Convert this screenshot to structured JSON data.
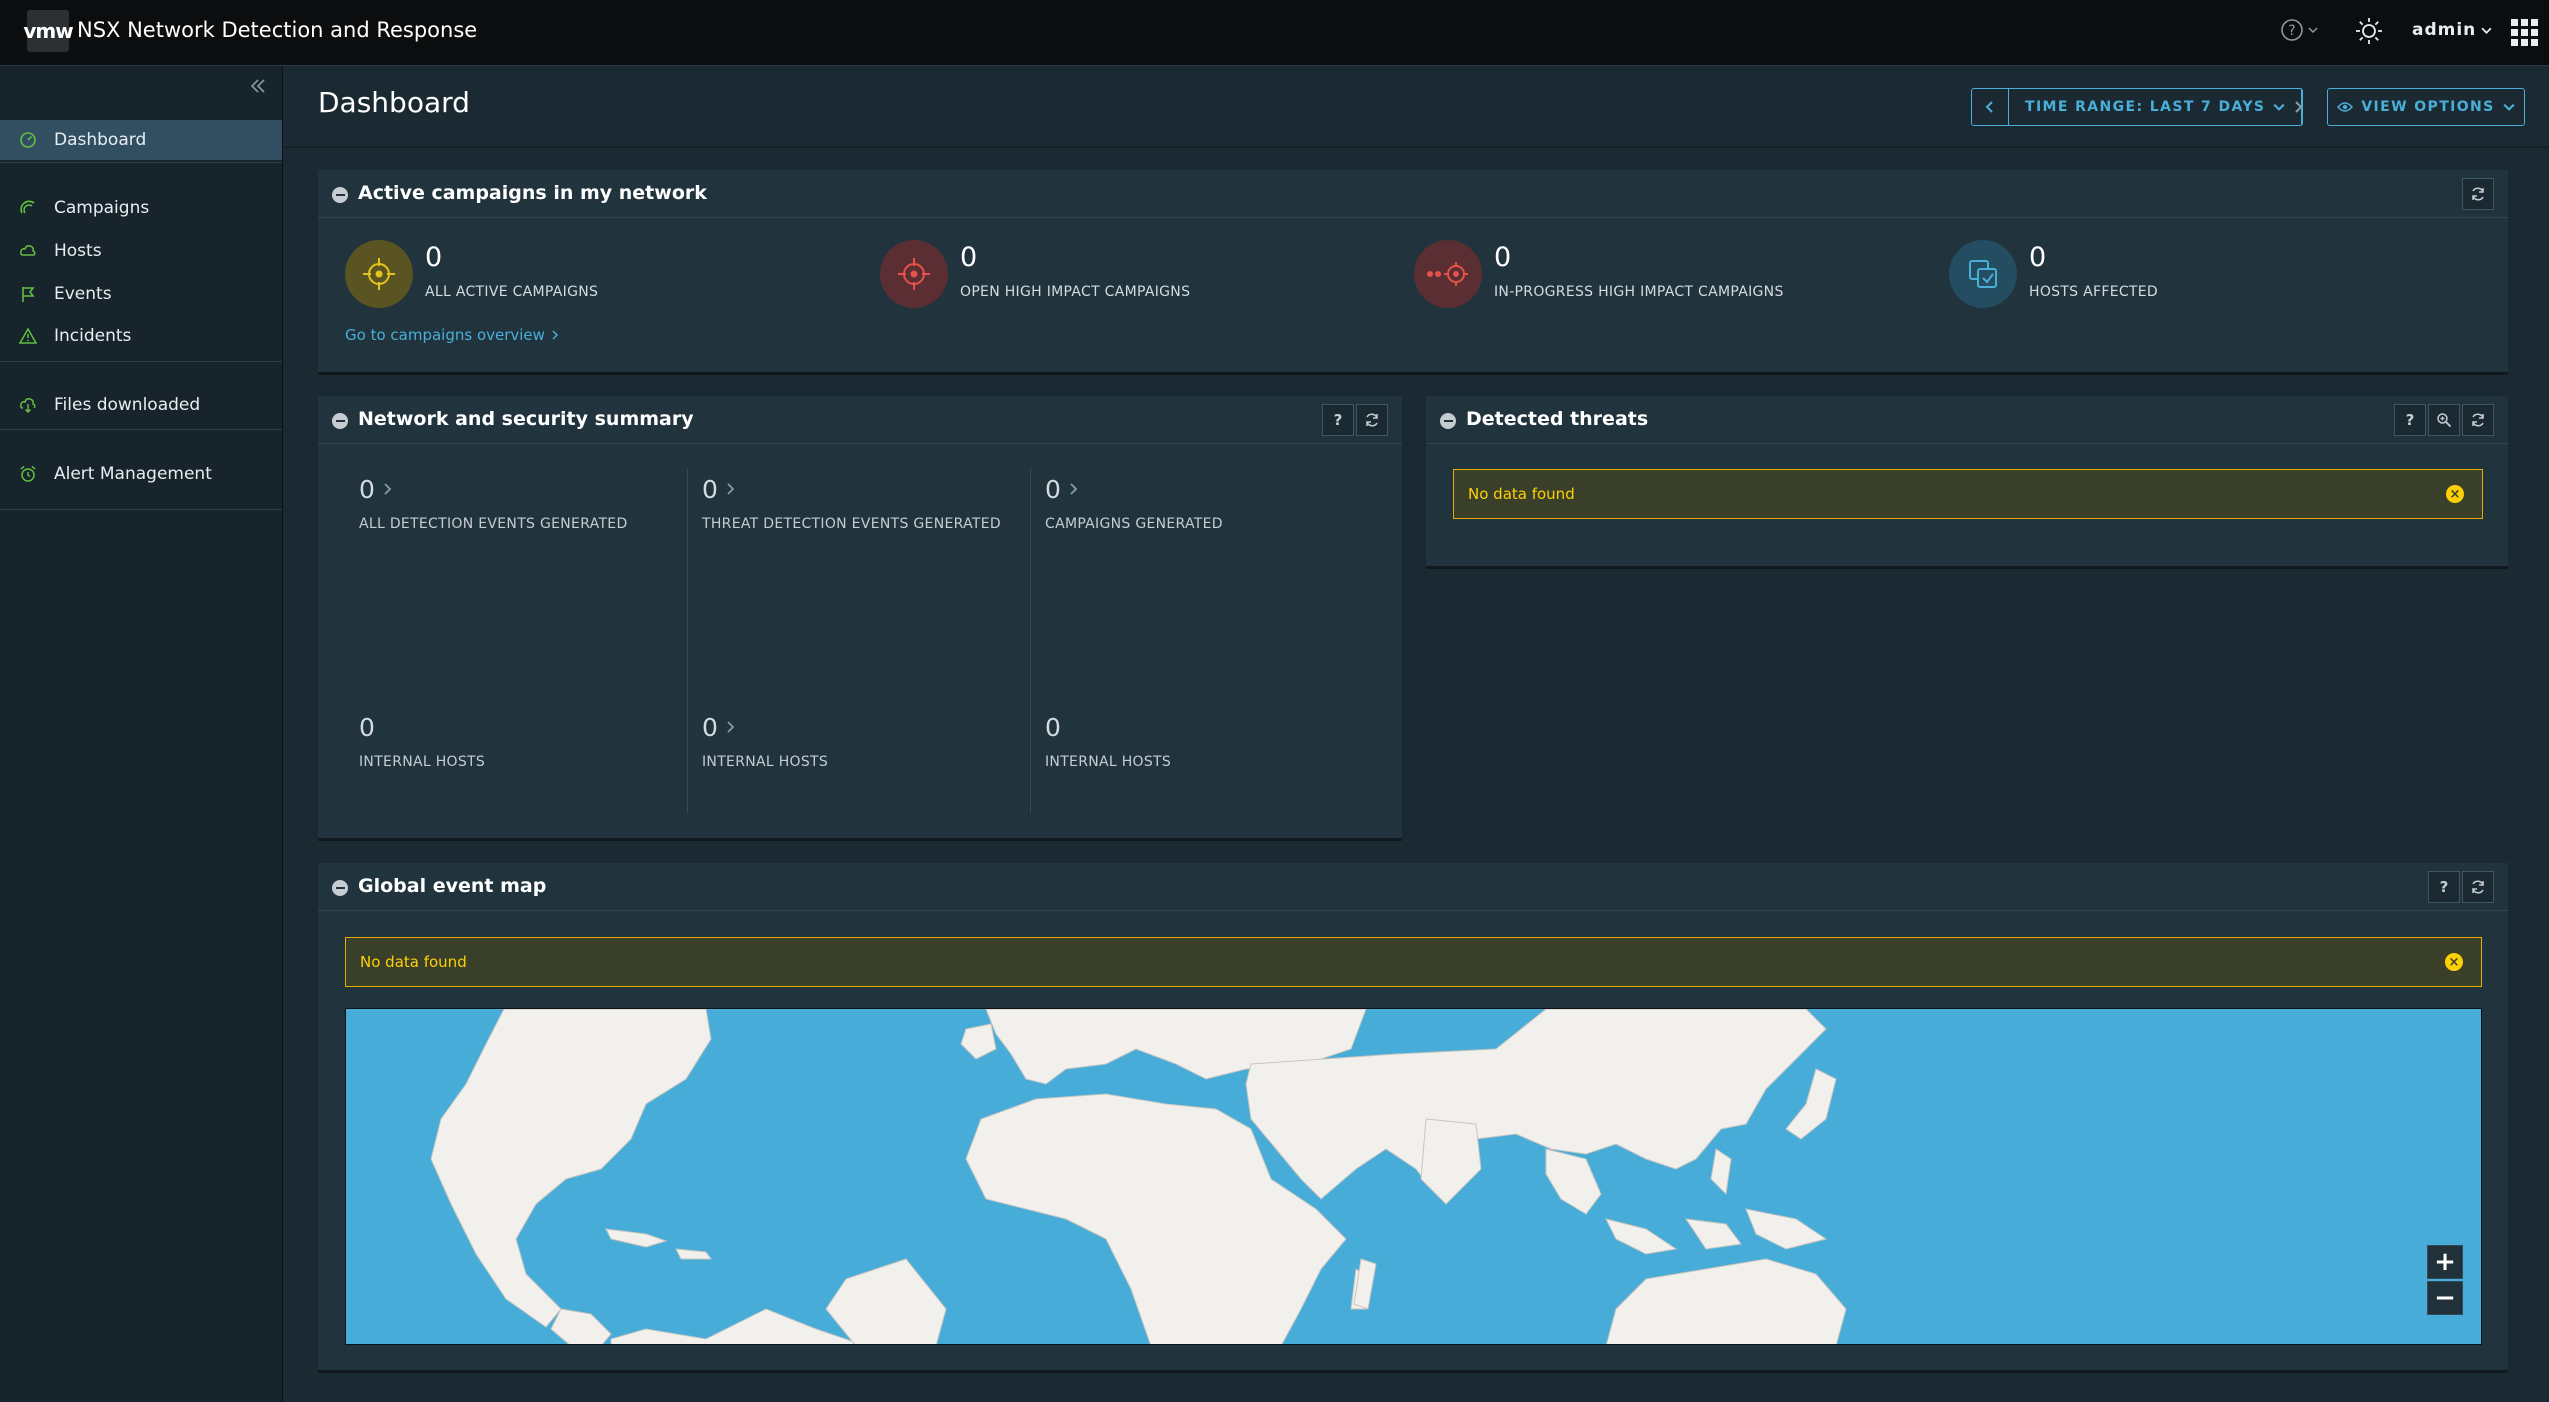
{
  "header": {
    "logo_text": "vmw",
    "app_title": "NSX Network Detection and Response",
    "user_label": "admin",
    "icons": [
      "help-icon",
      "theme-icon",
      "apps-grid-icon"
    ]
  },
  "sidebar": {
    "items": [
      {
        "label": "Dashboard",
        "icon": "dashboard-icon"
      },
      {
        "label": "Campaigns",
        "icon": "campaigns-icon"
      },
      {
        "label": "Hosts",
        "icon": "hosts-icon"
      },
      {
        "label": "Events",
        "icon": "flag-icon"
      },
      {
        "label": "Incidents",
        "icon": "warning-icon"
      },
      {
        "label": "Files downloaded",
        "icon": "cloud-download-icon"
      },
      {
        "label": "Alert Management",
        "icon": "alarm-clock-icon"
      }
    ]
  },
  "page": {
    "title": "Dashboard",
    "time_range_label": "TIME RANGE: LAST 7 DAYS",
    "view_options_label": "VIEW OPTIONS"
  },
  "active_campaigns": {
    "title": "Active campaigns in my network",
    "stats": [
      {
        "value": "0",
        "label": "ALL ACTIVE CAMPAIGNS",
        "color": "#e6c21c"
      },
      {
        "value": "0",
        "label": "OPEN HIGH IMPACT CAMPAIGNS",
        "color": "#e4524a"
      },
      {
        "value": "0",
        "label": "IN-PROGRESS HIGH IMPACT CAMPAIGNS",
        "color": "#e4524a"
      },
      {
        "value": "0",
        "label": "HOSTS AFFECTED",
        "color": "#49afd9"
      }
    ],
    "link_label": "Go to campaigns overview"
  },
  "network_summary": {
    "title": "Network and security summary",
    "top": [
      {
        "value": "0",
        "label": "ALL DETECTION EVENTS GENERATED"
      },
      {
        "value": "0",
        "label": "THREAT DETECTION EVENTS GENERATED"
      },
      {
        "value": "0",
        "label": "CAMPAIGNS GENERATED"
      }
    ],
    "bottom": [
      {
        "value": "0",
        "label": "INTERNAL HOSTS"
      },
      {
        "value": "0",
        "label": "INTERNAL HOSTS"
      },
      {
        "value": "0",
        "label": "INTERNAL HOSTS"
      }
    ]
  },
  "detected_threats": {
    "title": "Detected threats",
    "message": "No data found"
  },
  "global_map": {
    "title": "Global event map",
    "message": "No data found",
    "zoom_in": "+",
    "zoom_out": "−"
  },
  "colors": {
    "accent": "#49afd9",
    "warning": "#fdd006",
    "sidebar_active": "#324f62"
  }
}
